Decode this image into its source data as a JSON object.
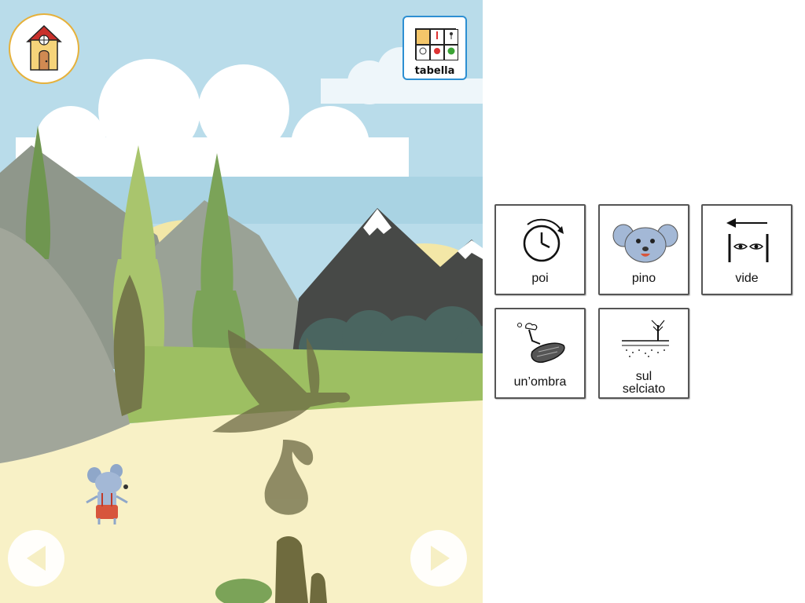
{
  "toolbar": {
    "home_icon": "house-icon",
    "tabella_label": "tabella",
    "tabella_icon": "symbol-grid-icon"
  },
  "navigation": {
    "prev_icon": "triangle-left-icon",
    "next_icon": "triangle-right-icon"
  },
  "symbol_cards": [
    {
      "label": "poi",
      "icon": "clock-icon"
    },
    {
      "label": "pino",
      "icon": "mouse-face-icon"
    },
    {
      "label": "vide",
      "icon": "eyes-arrow-icon"
    },
    {
      "label": "un’ombra",
      "icon": "shadow-icon"
    },
    {
      "label_line1": "sul",
      "label_line2": "selciato",
      "icon": "pavement-tree-icon"
    }
  ],
  "colors": {
    "sky": "#b9dcea",
    "sand": "#f8f1c6",
    "home_border": "#e6b13b",
    "tabella_border": "#2d8fd2"
  }
}
